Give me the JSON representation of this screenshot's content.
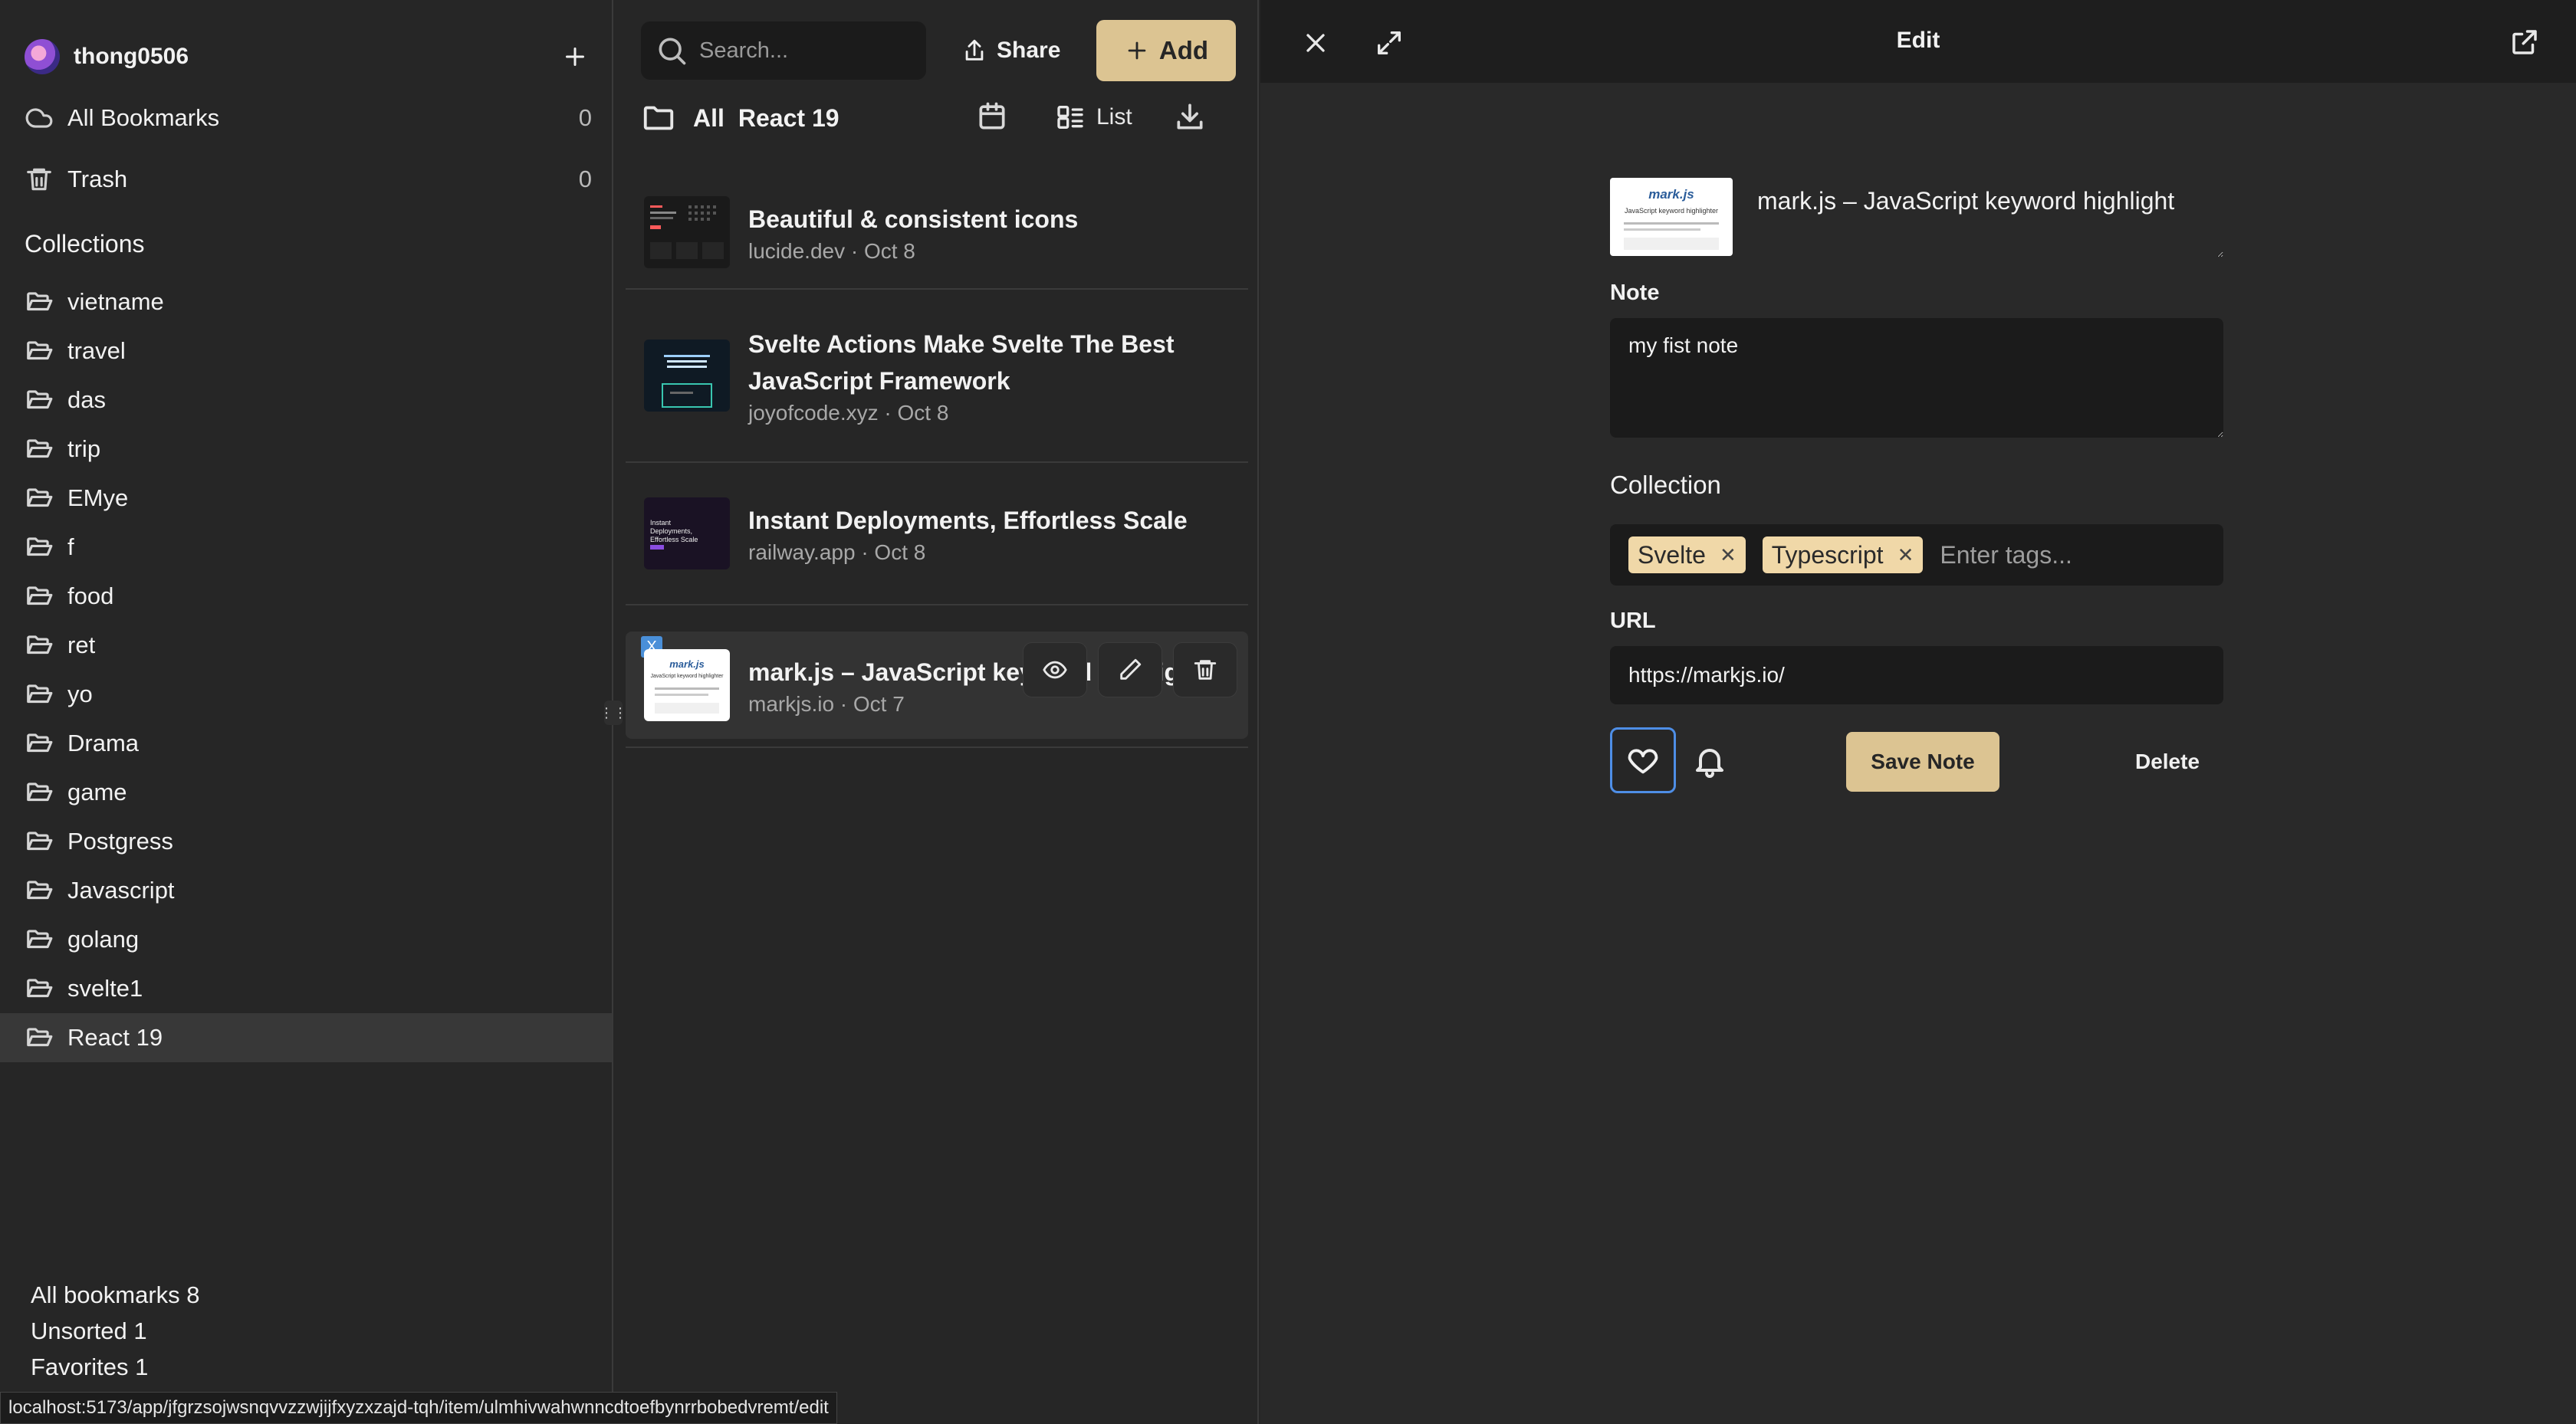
{
  "sidebar": {
    "username": "thong0506",
    "nav": [
      {
        "label": "All Bookmarks",
        "count": "0",
        "icon": "cloud-icon"
      },
      {
        "label": "Trash",
        "count": "0",
        "icon": "trash-icon"
      }
    ],
    "collections_title": "Collections",
    "collections": [
      "vietname",
      "travel",
      "das",
      "trip",
      "EMye",
      "f",
      "food",
      "ret",
      "yo",
      "Drama",
      "game",
      "Postgress",
      "Javascript",
      "golang",
      "svelte1",
      "React 19"
    ],
    "active_collection": "React 19",
    "stats": [
      "All bookmarks 8",
      "Unsorted 1",
      "Favorites 1"
    ]
  },
  "statusbar": {
    "url": "localhost:5173/app/jfgrzsojwsnqvvzzwjijfxyzxzajd-tqh/item/ulmhivwahwnncdtoefbynrrbobedvremt/edit"
  },
  "list": {
    "search_placeholder": "Search...",
    "share_label": "Share",
    "add_label": "Add",
    "crumb_all": "All",
    "crumb_current": "React 19",
    "view_label": "List",
    "bookmarks": [
      {
        "title": "Beautiful & consistent icons",
        "meta": "lucide.dev · Oct 8"
      },
      {
        "title": "Svelte Actions Make Svelte The Best JavaScript Framework",
        "meta": "joyofcode.xyz · Oct 8"
      },
      {
        "title": "Instant Deployments, Effortless Scale",
        "meta": "railway.app · Oct 8"
      },
      {
        "title": "mark.js – JavaScript keyword highlight",
        "meta": "markjs.io · Oct 7"
      }
    ],
    "thumb_texts": {
      "railway": "Instant Deployments, Effortless Scale",
      "markjs": "mark.js",
      "markjs_sub": "JavaScript keyword highlighter"
    },
    "selected_badge": "X"
  },
  "editor": {
    "header_title": "Edit",
    "title_value": "mark.js – JavaScript keyword highlight",
    "note_label": "Note",
    "note_value": "my fist note",
    "collection_label": "Collection",
    "tags": [
      "Svelte",
      "Typescript"
    ],
    "tag_placeholder": "Enter tags...",
    "url_label": "URL",
    "url_value": "https://markjs.io/",
    "save_label": "Save Note",
    "delete_label": "Delete"
  },
  "colors": {
    "accent": "#dcc492",
    "focus": "#4e8ee6",
    "background": "#262626"
  }
}
